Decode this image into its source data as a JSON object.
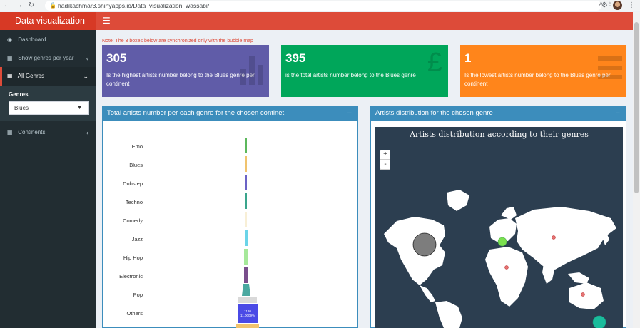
{
  "browser": {
    "url": "hadikachmar3.shinyapps.io/Data_visualization_wassabi/",
    "back_icon": "arrow-left-icon",
    "forward_icon": "arrow-right-icon",
    "reload_icon": "reload-icon"
  },
  "app": {
    "title": "Data visualization",
    "accent": "#dd4b39"
  },
  "sidebar": {
    "items": [
      {
        "label": "Dashboard",
        "icon": "dashboard-icon"
      },
      {
        "label": "Show genres per year",
        "icon": "calendar-icon"
      },
      {
        "label": "All Genres",
        "icon": "calendar-icon"
      },
      {
        "label": "Continents",
        "icon": "calendar-icon"
      }
    ],
    "genres_label": "Genres",
    "genres_selected": "Blues"
  },
  "note": "Note: The 3 boxes below are synchronized only with the bubble map",
  "value_boxes": [
    {
      "value": "305",
      "text": "Is the highest artists number belong to the Blues genre per continent",
      "color": "#605ca8",
      "icon": "bar-chart-icon"
    },
    {
      "value": "395",
      "text": "is the total artists number belong to the Blues genre",
      "color": "#00a65a",
      "icon": "pound-icon"
    },
    {
      "value": "1",
      "text": "Is the lowest artists number belong to the Blues genre per continent",
      "color": "#ff851b",
      "icon": "list-icon"
    }
  ],
  "panel_left": {
    "title": "Total artists number per each genre for the chosen continet",
    "genres": [
      "Emo",
      "Blues",
      "Dubstep",
      "Techno",
      "Comedy",
      "Jazz",
      "Hip Hop",
      "Electronic",
      "Pop",
      "Others"
    ],
    "bottom_label_1": "1120",
    "bottom_label_2": "11.0009%"
  },
  "panel_right": {
    "title": "Artists distribution for the chosen genre",
    "map_title": "Artists distribution according to their genres",
    "zoom_in": "+",
    "zoom_out": "-"
  }
}
